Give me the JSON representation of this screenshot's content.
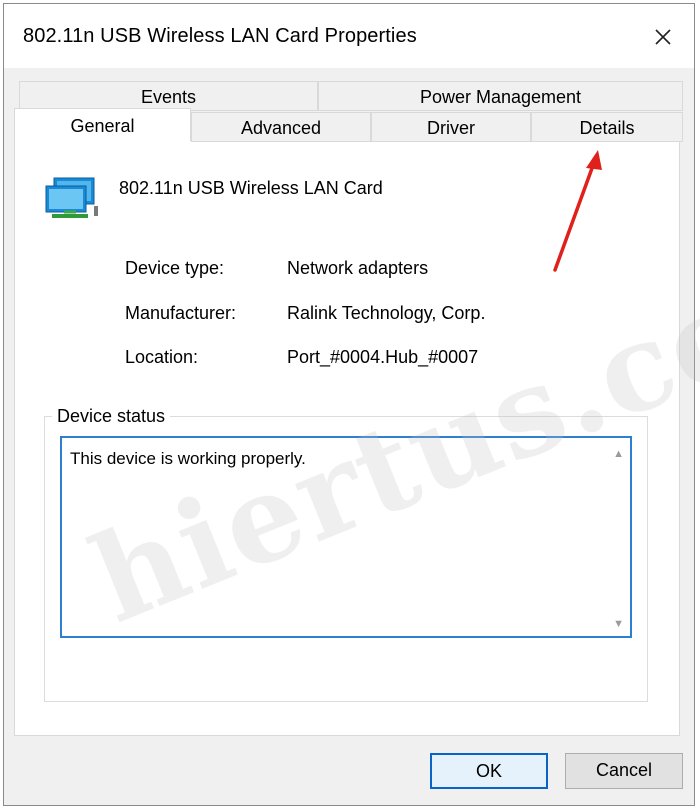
{
  "window": {
    "title": "802.11n USB Wireless LAN Card Properties",
    "close_icon": "close-icon"
  },
  "tabs": {
    "row1": [
      {
        "label": "Events"
      },
      {
        "label": "Power Management"
      }
    ],
    "row2": [
      {
        "label": "General",
        "active": true
      },
      {
        "label": "Advanced"
      },
      {
        "label": "Driver"
      },
      {
        "label": "Details"
      }
    ]
  },
  "device": {
    "icon": "network-adapter-icon",
    "name": "802.11n USB Wireless LAN Card"
  },
  "properties": [
    {
      "label": "Device type:",
      "value": "Network adapters"
    },
    {
      "label": "Manufacturer:",
      "value": "Ralink Technology, Corp."
    },
    {
      "label": "Location:",
      "value": "Port_#0004.Hub_#0007"
    }
  ],
  "status": {
    "group_label": "Device status",
    "text": "This device is working properly."
  },
  "buttons": {
    "ok": "OK",
    "cancel": "Cancel"
  },
  "watermark": "hiertus.com",
  "colors": {
    "accent": "#2f7fd1",
    "annotation_arrow": "#e0211b"
  }
}
